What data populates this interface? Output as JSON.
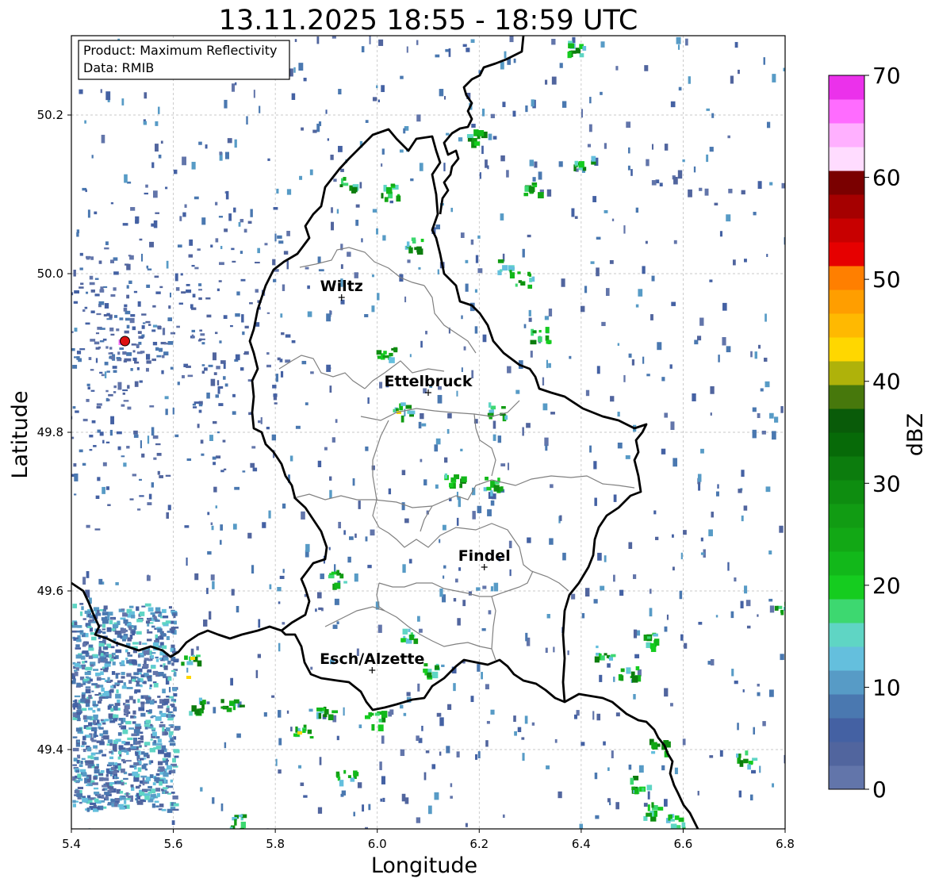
{
  "map": {
    "title": "13.11.2025 18:55 - 18:59 UTC",
    "info_box": {
      "product_line": "Product: Maximum Reflectivity",
      "data_line": "Data: RMIB"
    },
    "xlabel": "Longitude",
    "ylabel": "Latitude",
    "extent": {
      "lon": [
        5.4,
        6.8
      ],
      "lat": [
        49.3,
        50.3
      ]
    },
    "xticks": [
      5.4,
      5.6,
      5.8,
      6.0,
      6.2,
      6.4,
      6.6,
      6.8
    ],
    "yticks": [
      49.4,
      49.6,
      49.8,
      50.0,
      50.2
    ],
    "x_tick_labels": [
      "5.4",
      "5.6",
      "5.8",
      "6.0",
      "6.2",
      "6.4",
      "6.6",
      "6.8"
    ],
    "y_tick_labels": [
      "49.4",
      "49.6",
      "49.8",
      "50.0",
      "50.2"
    ],
    "grid": true,
    "cities": [
      {
        "name": "Wiltz",
        "lon": 5.93,
        "lat": 49.97
      },
      {
        "name": "Ettelbruck",
        "lon": 6.1,
        "lat": 49.85
      },
      {
        "name": "Findel",
        "lon": 6.21,
        "lat": 49.63
      },
      {
        "name": "Esch/Alzette",
        "lon": 5.99,
        "lat": 49.5
      }
    ],
    "radar_site": {
      "lon": 5.505,
      "lat": 49.915,
      "color": "#dd1111"
    },
    "colorbar": {
      "label": "dBZ",
      "min": 0,
      "max": 70,
      "tick_values": [
        0,
        10,
        20,
        30,
        40,
        50,
        60,
        70
      ],
      "tick_labels": [
        "0",
        "10",
        "20",
        "30",
        "40",
        "50",
        "60",
        "70"
      ],
      "colors": [
        "#6275aa",
        "#51659e",
        "#4461a3",
        "#4a78b0",
        "#579bc6",
        "#64bfdd",
        "#5fd5c4",
        "#3dd870",
        "#15cc1f",
        "#12b81a",
        "#12a815",
        "#119c13",
        "#0e8d10",
        "#0c7c0d",
        "#076a08",
        "#095b09",
        "#47780c",
        "#afb20a",
        "#ffd700",
        "#ffb901",
        "#ff9e00",
        "#ff7f00",
        "#e60000",
        "#c80000",
        "#a50000",
        "#7a0000",
        "#ffdcff",
        "#ffb0ff",
        "#ff6cff",
        "#eb31eb"
      ]
    },
    "colors": {
      "border_luxembourg": "#000000",
      "canton_lines": "#808080",
      "grid": "#b8b8b8"
    }
  }
}
